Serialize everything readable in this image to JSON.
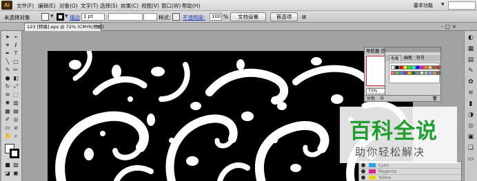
{
  "app": {
    "logo": "Ai"
  },
  "menu": [
    "文件(F)",
    "编辑(E)",
    "对象(O)",
    "文字(T)",
    "选择(S)",
    "效果(C)",
    "视图(V)",
    "窗口(W)",
    "帮助(H)"
  ],
  "workspace": {
    "label": "基本功能"
  },
  "controlbar": {
    "selection_label": "未选择对象",
    "stroke_label": "描边",
    "stroke_weight": "1 pt",
    "style_label": "样式:",
    "opacity_label": "不透明度:",
    "opacity_value": "100",
    "opacity_unit": "%",
    "doc_setup_button": "文档设置",
    "preferences_button": "首选项"
  },
  "document_tab": {
    "title": "123 [转换].eps @ 72% (CMYK/预览)",
    "close": "×"
  },
  "navigator": {
    "tab_navigator": "导航器",
    "tab_info": "信",
    "zoom": "73%"
  },
  "swatches": {
    "tabs": [
      "色板",
      "画笔",
      "符号"
    ],
    "colors": [
      "#ffffff",
      "#000000",
      "#ff0000",
      "#ffff00",
      "#00ff00",
      "#00ffff",
      "#0000ff",
      "#ff00ff",
      "#ff8000",
      "#ffcc99",
      "#996633",
      "#cc3333",
      "#ff6699",
      "#66cc33",
      "#3399cc",
      "#993399",
      "#cccc00",
      "#336633",
      "#669999",
      "#ffcccc",
      "#99cc99",
      "#9999ff",
      "#cc9966",
      "#666666"
    ]
  },
  "layers": {
    "tabs": [
      "分色",
      "分",
      "图"
    ],
    "rows": [
      {
        "color": "#22a7e0",
        "label": "Cyan"
      },
      {
        "color": "#e0218a",
        "label": "Magenta"
      },
      {
        "color": "#e8d517",
        "label": "Yellow"
      }
    ]
  },
  "watermark": {
    "title": "百科全说",
    "subtitle": "助你轻松解决"
  },
  "window_controls": "- □ ×"
}
